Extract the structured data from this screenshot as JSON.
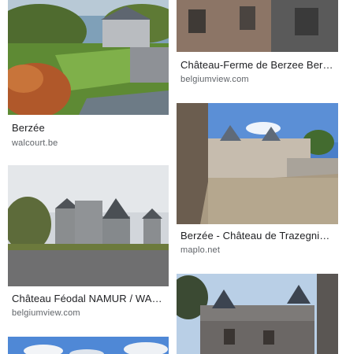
{
  "results": [
    {
      "title": "Berzée",
      "source": "walcourt.be"
    },
    {
      "title": "Château-Ferme de Berzee Ber…",
      "source": "belgiumview.com"
    },
    {
      "title": "Château Féodal NAMUR / WA…",
      "source": "belgiumview.com"
    },
    {
      "title": "Berzée - Château de Trazegni…",
      "source": "maplo.net"
    }
  ],
  "colors": {
    "title": "#202124",
    "source": "#5f6368",
    "background": "#ffffff"
  }
}
